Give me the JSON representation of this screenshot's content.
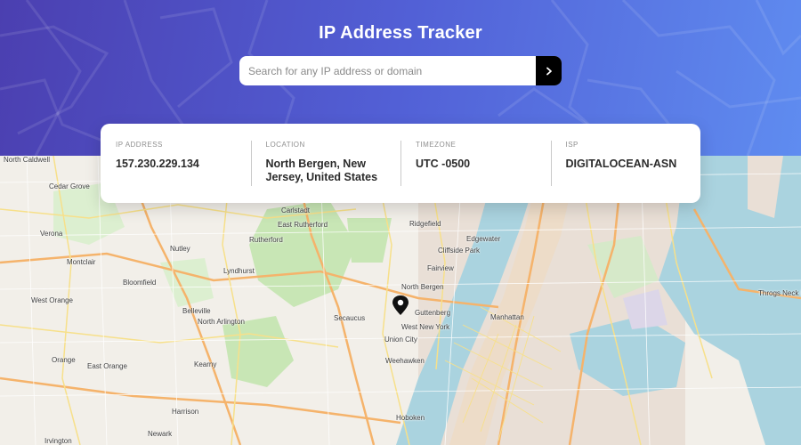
{
  "app": {
    "title": "IP Address Tracker"
  },
  "search": {
    "placeholder": "Search for any IP address or domain",
    "value": "",
    "submit_icon": "chevron-right-icon"
  },
  "info": {
    "ip_label": "IP ADDRESS",
    "ip_value": "157.230.229.134",
    "location_label": "LOCATION",
    "location_value": "North Bergen, New Jersey, United States",
    "timezone_label": "TIMEZONE",
    "timezone_value": "UTC -0500",
    "isp_label": "ISP",
    "isp_value": "DIGITALOCEAN-ASN"
  },
  "map": {
    "marker_icon": "location-pin-icon",
    "labels": {
      "north_caldwell": "North Caldwell",
      "cedar_grove": "Cedar Grove",
      "verona": "Verona",
      "montclair": "Montclair",
      "bloomfield": "Bloomfield",
      "west_orange": "West Orange",
      "orange": "Orange",
      "east_orange": "East Orange",
      "irvington": "Irvington",
      "nutley": "Nutley",
      "belleville": "Belleville",
      "north_arlington": "North Arlington",
      "kearny": "Kearny",
      "harrison": "Harrison",
      "newark": "Newark",
      "lyndhurst": "Lyndhurst",
      "rutherford": "Rutherford",
      "carlstadt": "Carlstadt",
      "east_rutherford": "East Rutherford",
      "ridgefield": "Ridgefield",
      "edgewater": "Edgewater",
      "cliffside_park": "Cliffside Park",
      "fairview": "Fairview",
      "north_bergen": "North Bergen",
      "secaucus": "Secaucus",
      "guttenberg": "Guttenberg",
      "west_new_york": "West New York",
      "union_city": "Union City",
      "weehawken": "Weehawken",
      "hoboken": "Hoboken",
      "manhattan": "Manhattan",
      "throgs_neck_bridge": "Throgs Neck Bridge"
    }
  },
  "colors": {
    "header_start": "#4b3fb0",
    "header_end": "#5f8cf0",
    "button": "#000000",
    "water": "#aad3df",
    "land": "#f2efe9",
    "park": "#c8e6b5"
  }
}
